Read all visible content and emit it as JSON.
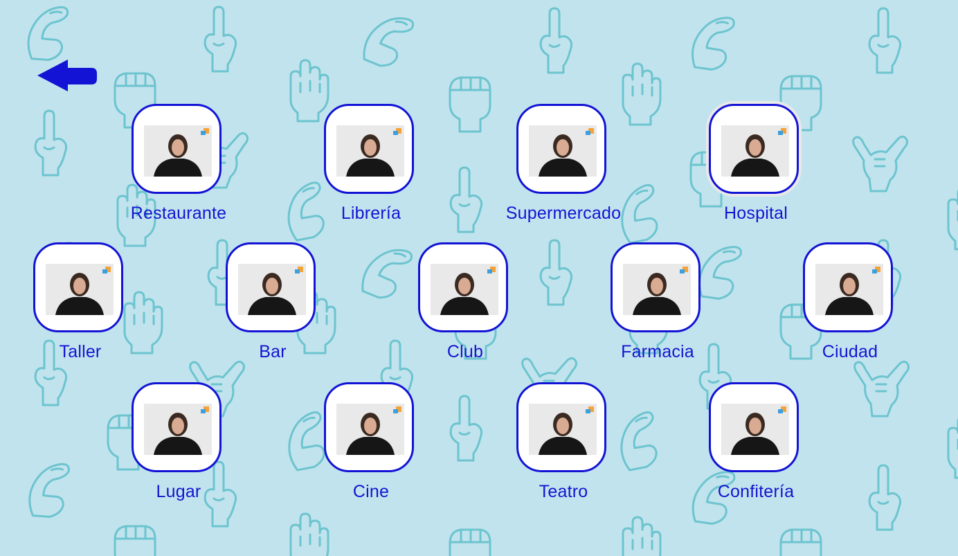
{
  "colors": {
    "background": "#c1e3ed",
    "pattern": "#6cc4cf",
    "accent": "#1313d6",
    "label": "#1414d2",
    "tile_bg": "#ffffff"
  },
  "back_button": {
    "icon": "arrow-left-icon"
  },
  "items": [
    {
      "label": "Restaurante",
      "row": 1,
      "col": 1
    },
    {
      "label": "Librería",
      "row": 1,
      "col": 2
    },
    {
      "label": "Supermercado",
      "row": 1,
      "col": 3
    },
    {
      "label": "Hospital",
      "row": 1,
      "col": 4,
      "selected": true
    },
    {
      "label": "Taller",
      "row": 2,
      "col": 1
    },
    {
      "label": "Bar",
      "row": 2,
      "col": 2
    },
    {
      "label": "Club",
      "row": 2,
      "col": 3
    },
    {
      "label": "Farmacia",
      "row": 2,
      "col": 4
    },
    {
      "label": "Ciudad",
      "row": 2,
      "col": 5
    },
    {
      "label": "Lugar",
      "row": 3,
      "col": 1
    },
    {
      "label": "Cine",
      "row": 3,
      "col": 2
    },
    {
      "label": "Teatro",
      "row": 3,
      "col": 3
    },
    {
      "label": "Confitería",
      "row": 3,
      "col": 4
    }
  ]
}
